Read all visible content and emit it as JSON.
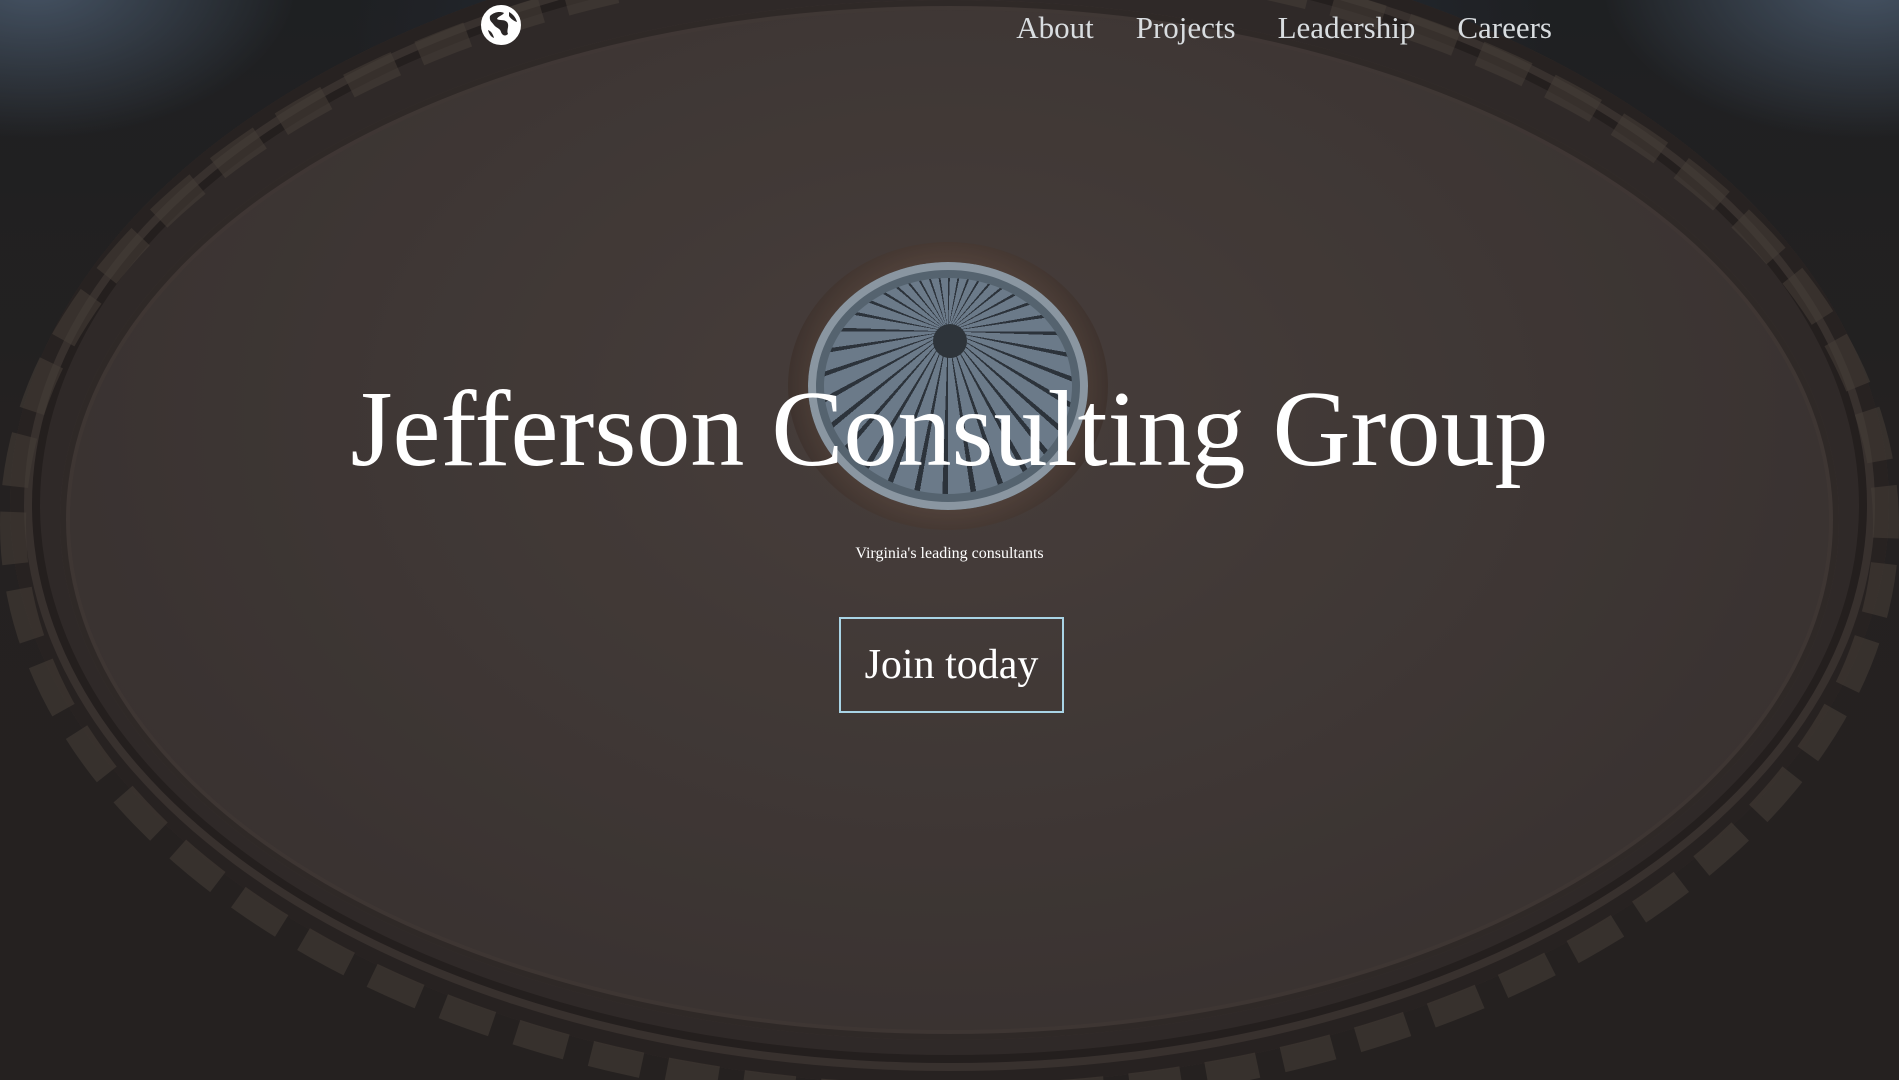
{
  "brand": {
    "logo_icon": "globe-icon"
  },
  "nav": {
    "links": [
      {
        "label": "About"
      },
      {
        "label": "Projects"
      },
      {
        "label": "Leadership"
      },
      {
        "label": "Careers"
      }
    ]
  },
  "hero": {
    "title": "Jefferson Consulting Group",
    "subtitle": "Virginia's leading consultants",
    "cta_label": "Join today"
  },
  "colors": {
    "text": "#ffffff",
    "nav_text": "#d9dde0",
    "cta_border": "#a9d4e6",
    "background": "#2e2a2a"
  }
}
